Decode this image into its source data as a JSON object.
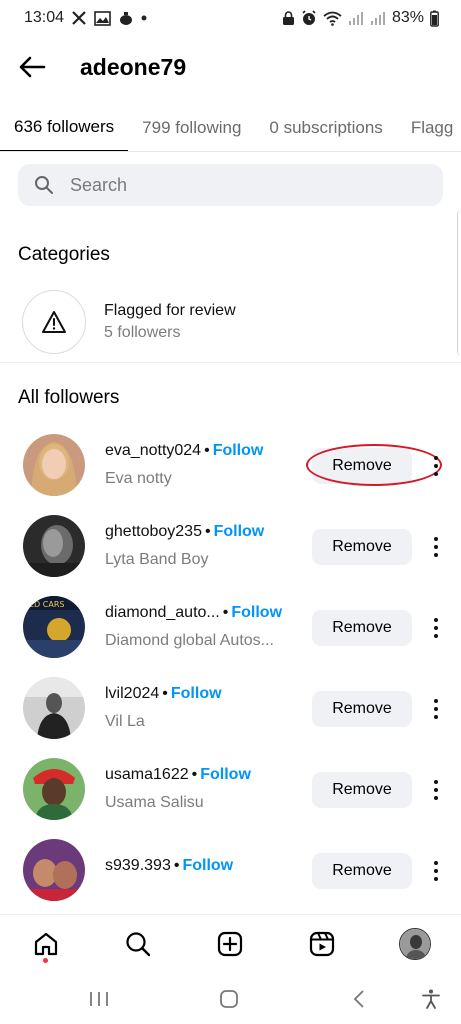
{
  "status_bar": {
    "time": "13:04",
    "left_icons": [
      "x-icon",
      "gallery-icon",
      "teapot-icon",
      "dot-icon"
    ],
    "right_icons": [
      "lock-icon",
      "alarm-icon",
      "wifi-icon",
      "signal-icon",
      "signal-icon"
    ],
    "battery": "83%"
  },
  "header": {
    "title": "adeone79",
    "back_icon": "arrow-left-icon"
  },
  "tabs": [
    {
      "label": "636 followers",
      "active": true
    },
    {
      "label": "799 following",
      "active": false
    },
    {
      "label": "0 subscriptions",
      "active": false
    },
    {
      "label": "Flagg",
      "active": false
    }
  ],
  "search": {
    "placeholder": "Search",
    "value": ""
  },
  "categories": {
    "title": "Categories",
    "items": [
      {
        "name": "Flagged for review",
        "count": "5 followers",
        "icon": "warning-triangle-icon"
      }
    ]
  },
  "followers": {
    "title": "All followers",
    "items": [
      {
        "username": "eva_notty024",
        "follow": "Follow",
        "name": "Eva notty",
        "remove": "Remove",
        "avatar_color": "#d7b49a"
      },
      {
        "username": "ghettoboy235",
        "follow": "Follow",
        "name": "Lyta Band Boy",
        "remove": "Remove",
        "avatar_color": "#3a3a3a"
      },
      {
        "username": "diamond_auto...",
        "follow": "Follow",
        "name": "Diamond global Autos...",
        "remove": "Remove",
        "avatar_color": "#1d2b4d"
      },
      {
        "username": "lvil2024",
        "follow": "Follow",
        "name": "Vil La",
        "remove": "Remove",
        "avatar_color": "#8a8a8a"
      },
      {
        "username": "usama1622",
        "follow": "Follow",
        "name": "Usama Salisu",
        "remove": "Remove",
        "avatar_color": "#c2453e"
      },
      {
        "username": "s939.393",
        "follow": "Follow",
        "name": "",
        "remove": "Remove",
        "avatar_color": "#b34a6a"
      }
    ]
  },
  "bottom_nav": {
    "items": [
      "home-icon",
      "search-icon",
      "create-icon",
      "reels-icon",
      "profile-avatar"
    ]
  },
  "system_nav": {
    "items": [
      "recents-icon",
      "home-circle-icon",
      "back-chevron-icon",
      "accessibility-icon"
    ]
  },
  "colors": {
    "link_blue": "#0095f6",
    "annotation_red": "#d11a2a",
    "button_gray": "#eff1f4"
  }
}
